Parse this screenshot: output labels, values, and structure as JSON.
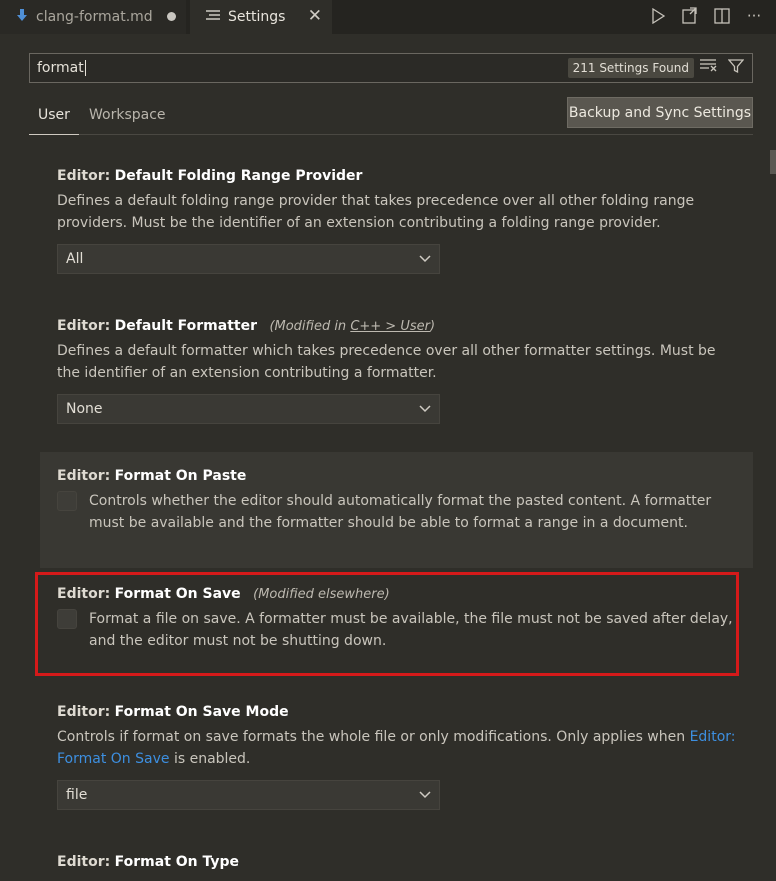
{
  "tabs": [
    {
      "label": "clang-format.md",
      "icon": "markdown-down-arrow-icon",
      "dirty": true
    },
    {
      "label": "Settings",
      "icon": "settings-lines-icon",
      "active": true
    }
  ],
  "tab_actions": [
    "run-icon",
    "open-settings-json-icon",
    "split-editor-icon",
    "more-actions-icon"
  ],
  "search": {
    "value": "format",
    "result_badge": "211 Settings Found"
  },
  "scope_tabs": {
    "user": "User",
    "workspace": "Workspace"
  },
  "sync_button": "Backup and Sync Settings",
  "settings": [
    {
      "category": "Editor:",
      "name": "Default Folding Range Provider",
      "description": "Defines a default folding range provider that takes precedence over all other folding range providers. Must be the identifier of an extension contributing a folding range provider.",
      "value": "All"
    },
    {
      "category": "Editor:",
      "name": "Default Formatter",
      "modified_prefix": "(Modified in ",
      "modified_link": "C++ > User",
      "modified_suffix": ")",
      "description": "Defines a default formatter which takes precedence over all other formatter settings. Must be the identifier of an extension contributing a formatter.",
      "value": "None"
    },
    {
      "category": "Editor:",
      "name": "Format On Paste",
      "description": "Controls whether the editor should automatically format the pasted content. A formatter must be available and the formatter should be able to format a range in a document.",
      "checked": false
    },
    {
      "category": "Editor:",
      "name": "Format On Save",
      "modified": "(Modified elsewhere)",
      "description": "Format a file on save. A formatter must be available, the file must not be saved after delay, and the editor must not be shutting down.",
      "checked": false
    },
    {
      "category": "Editor:",
      "name": "Format On Save Mode",
      "description_before": "Controls if format on save formats the whole file or only modifications. Only applies when ",
      "description_link": "Editor: Format On Save",
      "description_after": " is enabled.",
      "value": "file"
    },
    {
      "category": "Editor:",
      "name": "Format On Type"
    }
  ],
  "colors": {
    "highlight_border": "#d51a1a",
    "link": "#3d8fe0"
  }
}
